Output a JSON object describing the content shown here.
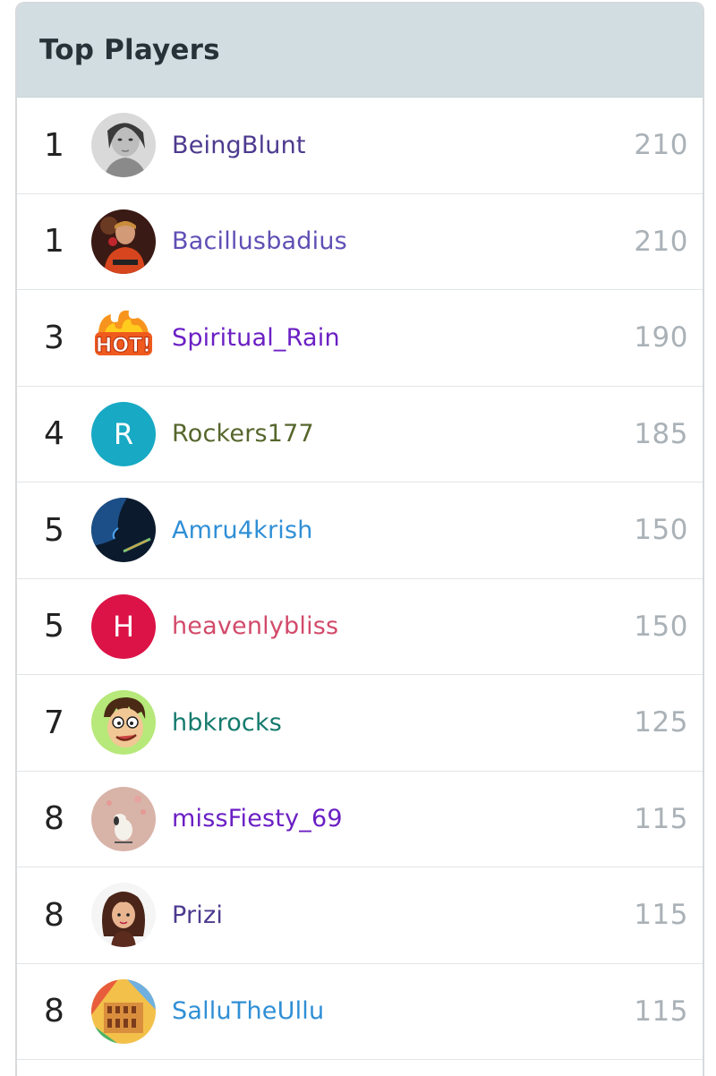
{
  "header": {
    "title": "Top Players"
  },
  "players": [
    {
      "rank": "1",
      "name": "BeingBlunt",
      "score": "210",
      "name_color": "#4d3a8f",
      "avatar_icon": "portrait-woman-icon"
    },
    {
      "rank": "1",
      "name": "Bacillusbadius",
      "score": "210",
      "name_color": "#5f4fb5",
      "avatar_icon": "cricketer-photo-icon"
    },
    {
      "rank": "3",
      "name": "Spiritual_Rain",
      "score": "190",
      "name_color": "#6b1fc4",
      "avatar_icon": "hot-sticker-icon"
    },
    {
      "rank": "4",
      "name": "Rockers177",
      "score": "185",
      "name_color": "#56662c",
      "avatar_letter": "R",
      "avatar_color": "#18a9c4"
    },
    {
      "rank": "5",
      "name": "Amru4krish",
      "score": "150",
      "name_color": "#2f8fd6",
      "avatar_icon": "dark-profile-icon"
    },
    {
      "rank": "5",
      "name": "heavenlybliss",
      "score": "150",
      "name_color": "#d24a6a",
      "avatar_letter": "H",
      "avatar_color": "#dc1347"
    },
    {
      "rank": "7",
      "name": "hbkrocks",
      "score": "125",
      "name_color": "#147a6d",
      "avatar_icon": "cartoon-face-icon"
    },
    {
      "rank": "8",
      "name": "missFiesty_69",
      "score": "115",
      "name_color": "#6b1fc4",
      "avatar_icon": "snoopy-icon"
    },
    {
      "rank": "8",
      "name": "Prizi",
      "score": "115",
      "name_color": "#4d3a8f",
      "avatar_icon": "cartoon-girl-icon"
    },
    {
      "rank": "8",
      "name": "SalluTheUllu",
      "score": "115",
      "name_color": "#2f8fd6",
      "avatar_icon": "colosseum-icon"
    }
  ]
}
